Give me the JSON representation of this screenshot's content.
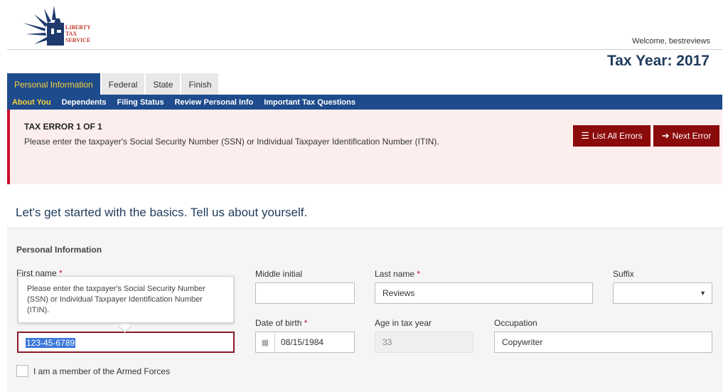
{
  "logo": {
    "line1": "LIBERTY",
    "line2": "TAX",
    "line3": "SERVICE"
  },
  "header": {
    "welcome": "Welcome, bestreviews",
    "tax_year": "Tax Year: 2017"
  },
  "tabs": [
    {
      "label": "Personal Information",
      "active": true
    },
    {
      "label": "Federal"
    },
    {
      "label": "State"
    },
    {
      "label": "Finish"
    }
  ],
  "subnav": [
    {
      "label": "About You",
      "active": true
    },
    {
      "label": "Dependents"
    },
    {
      "label": "Filing Status"
    },
    {
      "label": "Review Personal Info"
    },
    {
      "label": "Important Tax Questions"
    }
  ],
  "error": {
    "title": "TAX ERROR 1 OF 1",
    "message": "Please enter the taxpayer's Social Security Number (SSN) or Individual Taxpayer Identification Number (ITIN).",
    "list_all_label": "List All Errors",
    "next_label": "Next Error"
  },
  "intro": "Let's get started with the basics. Tell us about yourself.",
  "form": {
    "section_title": "Personal Information",
    "first_name_label": "First name",
    "required_mark": "*",
    "middle_initial_label": "Middle initial",
    "middle_initial_value": "",
    "last_name_label": "Last name",
    "last_name_value": "Reviews",
    "suffix_label": "Suffix",
    "suffix_value": "",
    "ssn_value": "123-45-6789",
    "dob_label": "Date of birth",
    "dob_value": "08/15/1984",
    "age_label": "Age in tax year",
    "age_value": "33",
    "occupation_label": "Occupation",
    "occupation_value": "Copywriter",
    "armed_forces_label": "I am a member of the Armed Forces",
    "tooltip": "Please enter the taxpayer's Social Security Number (SSN) or Individual Taxpayer Identification Number (ITIN)."
  },
  "colors": {
    "navy": "#1e4b8c",
    "active_tab_text": "#f5d23b",
    "error_red": "#8b0a0a",
    "error_bg": "#fdeeee"
  }
}
